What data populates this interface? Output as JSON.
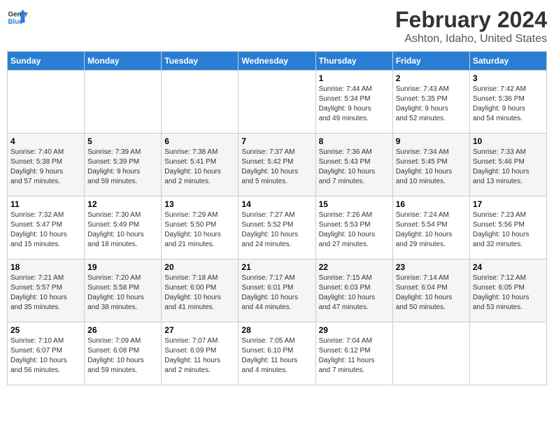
{
  "header": {
    "logo_general": "General",
    "logo_blue": "Blue",
    "title": "February 2024",
    "subtitle": "Ashton, Idaho, United States"
  },
  "days_of_week": [
    "Sunday",
    "Monday",
    "Tuesday",
    "Wednesday",
    "Thursday",
    "Friday",
    "Saturday"
  ],
  "weeks": [
    [
      {
        "num": "",
        "detail": ""
      },
      {
        "num": "",
        "detail": ""
      },
      {
        "num": "",
        "detail": ""
      },
      {
        "num": "",
        "detail": ""
      },
      {
        "num": "1",
        "detail": "Sunrise: 7:44 AM\nSunset: 5:34 PM\nDaylight: 9 hours\nand 49 minutes."
      },
      {
        "num": "2",
        "detail": "Sunrise: 7:43 AM\nSunset: 5:35 PM\nDaylight: 9 hours\nand 52 minutes."
      },
      {
        "num": "3",
        "detail": "Sunrise: 7:42 AM\nSunset: 5:36 PM\nDaylight: 9 hours\nand 54 minutes."
      }
    ],
    [
      {
        "num": "4",
        "detail": "Sunrise: 7:40 AM\nSunset: 5:38 PM\nDaylight: 9 hours\nand 57 minutes."
      },
      {
        "num": "5",
        "detail": "Sunrise: 7:39 AM\nSunset: 5:39 PM\nDaylight: 9 hours\nand 59 minutes."
      },
      {
        "num": "6",
        "detail": "Sunrise: 7:38 AM\nSunset: 5:41 PM\nDaylight: 10 hours\nand 2 minutes."
      },
      {
        "num": "7",
        "detail": "Sunrise: 7:37 AM\nSunset: 5:42 PM\nDaylight: 10 hours\nand 5 minutes."
      },
      {
        "num": "8",
        "detail": "Sunrise: 7:36 AM\nSunset: 5:43 PM\nDaylight: 10 hours\nand 7 minutes."
      },
      {
        "num": "9",
        "detail": "Sunrise: 7:34 AM\nSunset: 5:45 PM\nDaylight: 10 hours\nand 10 minutes."
      },
      {
        "num": "10",
        "detail": "Sunrise: 7:33 AM\nSunset: 5:46 PM\nDaylight: 10 hours\nand 13 minutes."
      }
    ],
    [
      {
        "num": "11",
        "detail": "Sunrise: 7:32 AM\nSunset: 5:47 PM\nDaylight: 10 hours\nand 15 minutes."
      },
      {
        "num": "12",
        "detail": "Sunrise: 7:30 AM\nSunset: 5:49 PM\nDaylight: 10 hours\nand 18 minutes."
      },
      {
        "num": "13",
        "detail": "Sunrise: 7:29 AM\nSunset: 5:50 PM\nDaylight: 10 hours\nand 21 minutes."
      },
      {
        "num": "14",
        "detail": "Sunrise: 7:27 AM\nSunset: 5:52 PM\nDaylight: 10 hours\nand 24 minutes."
      },
      {
        "num": "15",
        "detail": "Sunrise: 7:26 AM\nSunset: 5:53 PM\nDaylight: 10 hours\nand 27 minutes."
      },
      {
        "num": "16",
        "detail": "Sunrise: 7:24 AM\nSunset: 5:54 PM\nDaylight: 10 hours\nand 29 minutes."
      },
      {
        "num": "17",
        "detail": "Sunrise: 7:23 AM\nSunset: 5:56 PM\nDaylight: 10 hours\nand 32 minutes."
      }
    ],
    [
      {
        "num": "18",
        "detail": "Sunrise: 7:21 AM\nSunset: 5:57 PM\nDaylight: 10 hours\nand 35 minutes."
      },
      {
        "num": "19",
        "detail": "Sunrise: 7:20 AM\nSunset: 5:58 PM\nDaylight: 10 hours\nand 38 minutes."
      },
      {
        "num": "20",
        "detail": "Sunrise: 7:18 AM\nSunset: 6:00 PM\nDaylight: 10 hours\nand 41 minutes."
      },
      {
        "num": "21",
        "detail": "Sunrise: 7:17 AM\nSunset: 6:01 PM\nDaylight: 10 hours\nand 44 minutes."
      },
      {
        "num": "22",
        "detail": "Sunrise: 7:15 AM\nSunset: 6:03 PM\nDaylight: 10 hours\nand 47 minutes."
      },
      {
        "num": "23",
        "detail": "Sunrise: 7:14 AM\nSunset: 6:04 PM\nDaylight: 10 hours\nand 50 minutes."
      },
      {
        "num": "24",
        "detail": "Sunrise: 7:12 AM\nSunset: 6:05 PM\nDaylight: 10 hours\nand 53 minutes."
      }
    ],
    [
      {
        "num": "25",
        "detail": "Sunrise: 7:10 AM\nSunset: 6:07 PM\nDaylight: 10 hours\nand 56 minutes."
      },
      {
        "num": "26",
        "detail": "Sunrise: 7:09 AM\nSunset: 6:08 PM\nDaylight: 10 hours\nand 59 minutes."
      },
      {
        "num": "27",
        "detail": "Sunrise: 7:07 AM\nSunset: 6:09 PM\nDaylight: 11 hours\nand 2 minutes."
      },
      {
        "num": "28",
        "detail": "Sunrise: 7:05 AM\nSunset: 6:10 PM\nDaylight: 11 hours\nand 4 minutes."
      },
      {
        "num": "29",
        "detail": "Sunrise: 7:04 AM\nSunset: 6:12 PM\nDaylight: 11 hours\nand 7 minutes."
      },
      {
        "num": "",
        "detail": ""
      },
      {
        "num": "",
        "detail": ""
      }
    ]
  ]
}
